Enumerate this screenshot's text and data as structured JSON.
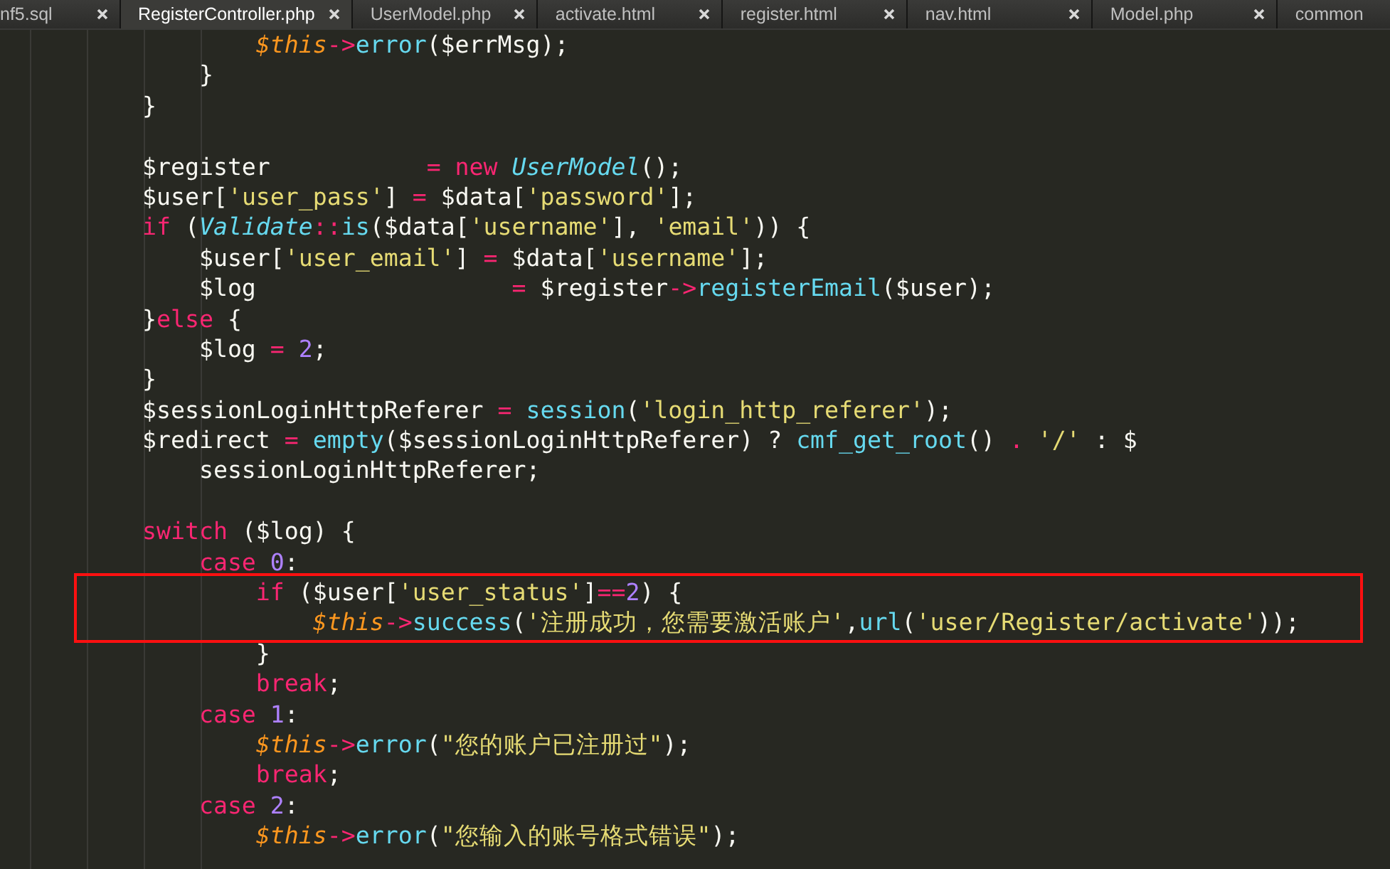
{
  "tabs": [
    {
      "label": "nf5.sql",
      "selected": false
    },
    {
      "label": "RegisterController.php",
      "selected": true
    },
    {
      "label": "UserModel.php",
      "selected": false
    },
    {
      "label": "activate.html",
      "selected": false
    },
    {
      "label": "register.html",
      "selected": false
    },
    {
      "label": "nav.html",
      "selected": false
    },
    {
      "label": "Model.php",
      "selected": false
    },
    {
      "label": "common",
      "selected": false
    }
  ],
  "lines": [
    {
      "kind": "code",
      "boxed": false,
      "tokens": [
        {
          "kind": "t",
          "text": "        $this"
        },
        {
          "kind": "k",
          "text": "->"
        },
        {
          "kind": "f",
          "text": "error"
        },
        {
          "kind": "p",
          "text": "($errMsg);"
        }
      ]
    },
    {
      "kind": "code",
      "boxed": false,
      "tokens": [
        {
          "kind": "p",
          "text": "    }"
        }
      ]
    },
    {
      "kind": "code",
      "boxed": false,
      "tokens": [
        {
          "kind": "p",
          "text": "}"
        }
      ]
    },
    {
      "kind": "blank"
    },
    {
      "kind": "code",
      "boxed": false,
      "tokens": [
        {
          "kind": "p",
          "text": "$register           "
        },
        {
          "kind": "k",
          "text": "= new "
        },
        {
          "kind": "c",
          "text": "UserModel"
        },
        {
          "kind": "p",
          "text": "();"
        }
      ]
    },
    {
      "kind": "code",
      "boxed": false,
      "tokens": [
        {
          "kind": "p",
          "text": "$user["
        },
        {
          "kind": "s",
          "text": "'user_pass'"
        },
        {
          "kind": "p",
          "text": "] "
        },
        {
          "kind": "k",
          "text": "="
        },
        {
          "kind": "p",
          "text": " $data["
        },
        {
          "kind": "s",
          "text": "'password'"
        },
        {
          "kind": "p",
          "text": "];"
        }
      ]
    },
    {
      "kind": "code",
      "boxed": false,
      "tokens": [
        {
          "kind": "k",
          "text": "if"
        },
        {
          "kind": "p",
          "text": " ("
        },
        {
          "kind": "c",
          "text": "Validate"
        },
        {
          "kind": "k",
          "text": "::"
        },
        {
          "kind": "f",
          "text": "is"
        },
        {
          "kind": "p",
          "text": "($data["
        },
        {
          "kind": "s",
          "text": "'username'"
        },
        {
          "kind": "p",
          "text": "], "
        },
        {
          "kind": "s",
          "text": "'email'"
        },
        {
          "kind": "p",
          "text": ")) {"
        }
      ]
    },
    {
      "kind": "code",
      "boxed": false,
      "tokens": [
        {
          "kind": "p",
          "text": "    $user["
        },
        {
          "kind": "s",
          "text": "'user_email'"
        },
        {
          "kind": "p",
          "text": "] "
        },
        {
          "kind": "k",
          "text": "="
        },
        {
          "kind": "p",
          "text": " $data["
        },
        {
          "kind": "s",
          "text": "'username'"
        },
        {
          "kind": "p",
          "text": "];"
        }
      ]
    },
    {
      "kind": "code",
      "boxed": false,
      "tokens": [
        {
          "kind": "p",
          "text": "    $log                  "
        },
        {
          "kind": "k",
          "text": "="
        },
        {
          "kind": "p",
          "text": " $register"
        },
        {
          "kind": "k",
          "text": "->"
        },
        {
          "kind": "f",
          "text": "registerEmail"
        },
        {
          "kind": "p",
          "text": "($user);"
        }
      ]
    },
    {
      "kind": "code",
      "boxed": false,
      "tokens": [
        {
          "kind": "p",
          "text": "}"
        },
        {
          "kind": "k",
          "text": "else"
        },
        {
          "kind": "p",
          "text": " {"
        }
      ]
    },
    {
      "kind": "code",
      "boxed": false,
      "tokens": [
        {
          "kind": "p",
          "text": "    $log "
        },
        {
          "kind": "k",
          "text": "= "
        },
        {
          "kind": "n",
          "text": "2"
        },
        {
          "kind": "p",
          "text": ";"
        }
      ]
    },
    {
      "kind": "code",
      "boxed": false,
      "tokens": [
        {
          "kind": "p",
          "text": "}"
        }
      ]
    },
    {
      "kind": "code",
      "boxed": false,
      "tokens": [
        {
          "kind": "p",
          "text": "$sessionLoginHttpReferer "
        },
        {
          "kind": "k",
          "text": "= "
        },
        {
          "kind": "f",
          "text": "session"
        },
        {
          "kind": "p",
          "text": "("
        },
        {
          "kind": "s",
          "text": "'login_http_referer'"
        },
        {
          "kind": "p",
          "text": ");"
        }
      ]
    },
    {
      "kind": "code",
      "boxed": false,
      "tokens": [
        {
          "kind": "p",
          "text": "$redirect "
        },
        {
          "kind": "k",
          "text": "= "
        },
        {
          "kind": "f",
          "text": "empty"
        },
        {
          "kind": "p",
          "text": "($sessionLoginHttpReferer) ? "
        },
        {
          "kind": "f",
          "text": "cmf_get_root"
        },
        {
          "kind": "p",
          "text": "() "
        },
        {
          "kind": "k",
          "text": ". "
        },
        {
          "kind": "s",
          "text": "'/'"
        },
        {
          "kind": "p",
          "text": " : $"
        }
      ]
    },
    {
      "kind": "code",
      "boxed": false,
      "tokens": [
        {
          "kind": "p",
          "text": "    sessionLoginHttpReferer;"
        }
      ]
    },
    {
      "kind": "blank"
    },
    {
      "kind": "code",
      "boxed": false,
      "tokens": [
        {
          "kind": "k",
          "text": "switch"
        },
        {
          "kind": "p",
          "text": " ($log) {"
        }
      ]
    },
    {
      "kind": "code",
      "boxed": false,
      "tokens": [
        {
          "kind": "k",
          "text": "    case "
        },
        {
          "kind": "n",
          "text": "0"
        },
        {
          "kind": "p",
          "text": ":"
        }
      ]
    },
    {
      "kind": "code",
      "boxed": true,
      "tokens": [
        {
          "kind": "k",
          "text": "        if"
        },
        {
          "kind": "p",
          "text": " ($user["
        },
        {
          "kind": "s",
          "text": "'user_status'"
        },
        {
          "kind": "p",
          "text": "]"
        },
        {
          "kind": "k",
          "text": "=="
        },
        {
          "kind": "n",
          "text": "2"
        },
        {
          "kind": "p",
          "text": ") {"
        }
      ]
    },
    {
      "kind": "code",
      "boxed": true,
      "tokens": [
        {
          "kind": "t",
          "text": "            $this"
        },
        {
          "kind": "k",
          "text": "->"
        },
        {
          "kind": "f",
          "text": "success"
        },
        {
          "kind": "p",
          "text": "("
        },
        {
          "kind": "s",
          "text": "'注册成功，您需要激活账户'"
        },
        {
          "kind": "p",
          "text": ","
        },
        {
          "kind": "f",
          "text": "url"
        },
        {
          "kind": "p",
          "text": "("
        },
        {
          "kind": "s",
          "text": "'user/Register/activate'"
        },
        {
          "kind": "p",
          "text": "));"
        }
      ]
    },
    {
      "kind": "code",
      "boxed": false,
      "tokens": [
        {
          "kind": "p",
          "text": "        }"
        }
      ]
    },
    {
      "kind": "code",
      "boxed": false,
      "tokens": [
        {
          "kind": "k",
          "text": "        break"
        },
        {
          "kind": "p",
          "text": ";"
        }
      ]
    },
    {
      "kind": "code",
      "boxed": false,
      "tokens": [
        {
          "kind": "k",
          "text": "    case "
        },
        {
          "kind": "n",
          "text": "1"
        },
        {
          "kind": "p",
          "text": ":"
        }
      ]
    },
    {
      "kind": "code",
      "boxed": false,
      "tokens": [
        {
          "kind": "t",
          "text": "        $this"
        },
        {
          "kind": "k",
          "text": "->"
        },
        {
          "kind": "f",
          "text": "error"
        },
        {
          "kind": "p",
          "text": "("
        },
        {
          "kind": "s",
          "text": "\"您的账户已注册过\""
        },
        {
          "kind": "p",
          "text": ");"
        }
      ]
    },
    {
      "kind": "code",
      "boxed": false,
      "tokens": [
        {
          "kind": "k",
          "text": "        break"
        },
        {
          "kind": "p",
          "text": ";"
        }
      ]
    },
    {
      "kind": "code",
      "boxed": false,
      "tokens": [
        {
          "kind": "k",
          "text": "    case "
        },
        {
          "kind": "n",
          "text": "2"
        },
        {
          "kind": "p",
          "text": ":"
        }
      ]
    },
    {
      "kind": "code",
      "boxed": false,
      "tokens": [
        {
          "kind": "t",
          "text": "        $this"
        },
        {
          "kind": "k",
          "text": "->"
        },
        {
          "kind": "f",
          "text": "error"
        },
        {
          "kind": "p",
          "text": "("
        },
        {
          "kind": "s",
          "text": "\"您输入的账号格式错误\""
        },
        {
          "kind": "p",
          "text": ");"
        }
      ]
    }
  ]
}
